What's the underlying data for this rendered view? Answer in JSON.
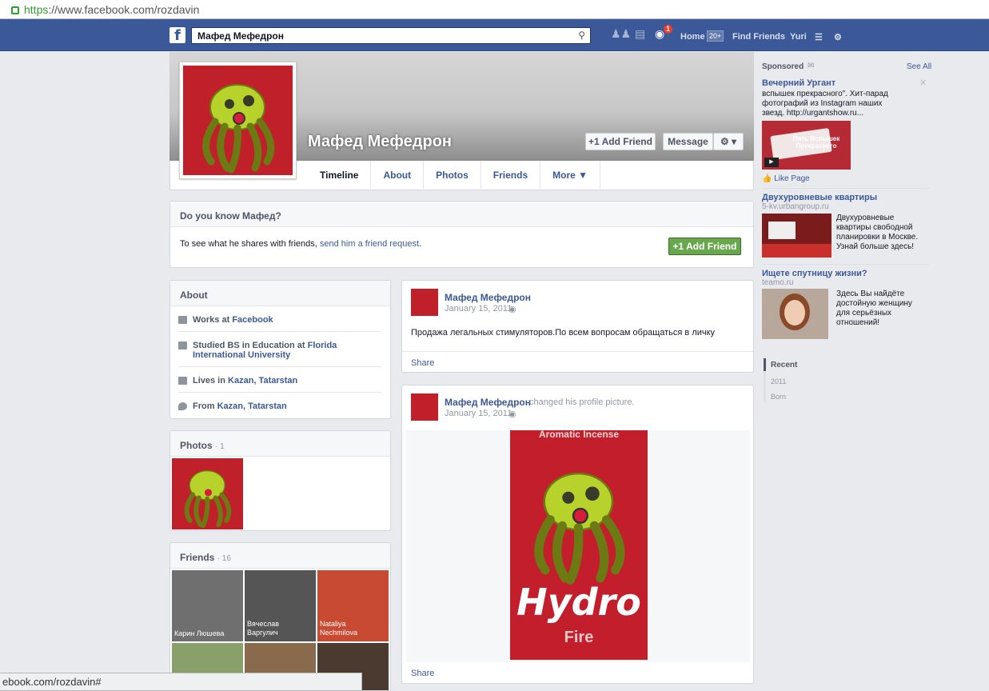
{
  "browser": {
    "url_https": "https",
    "url_rest": "://www.facebook.com/rozdavin"
  },
  "topbar": {
    "logo": "f",
    "search_value": "Мафед Мефедрон",
    "notif_badge": "1",
    "home_label": "Home",
    "home_count": "20+",
    "find_friends_label": "Find Friends",
    "user_label": "Yuri"
  },
  "profile": {
    "name": "Мафед Мефедрон",
    "add_friend_label": "Add Friend",
    "message_label": "Message",
    "tabs": [
      {
        "label": "Timeline"
      },
      {
        "label": "About"
      },
      {
        "label": "Photos"
      },
      {
        "label": "Friends"
      },
      {
        "label": "More ▼"
      }
    ]
  },
  "know": {
    "title": "Do you know Мафед?",
    "text": "To see what he shares with friends, ",
    "link": "send him a friend request",
    "dot": ".",
    "button": "Add Friend"
  },
  "about": {
    "title": "About",
    "works_pre": "Works at ",
    "works_link": "Facebook",
    "studied_pre": "Studied BS in Education at ",
    "studied_link": "Florida International University",
    "lives_pre": "Lives in ",
    "lives_link": "Kazan, Tatarstan",
    "from_pre": "From ",
    "from_link": "Kazan, Tatarstan"
  },
  "photos_box": {
    "title": "Photos",
    "count": "· 1"
  },
  "friends_box": {
    "title": "Friends",
    "count": "· 16",
    "names": [
      "Карин Люшева",
      "Вячеслав Варгулич",
      "Nataliya Nechmilova"
    ]
  },
  "posts": [
    {
      "author": "Мафед Мефедрон",
      "date": "January 15, 2011",
      "text": "Продажа легальных стимуляторов.По всем вопросам обращаться в личку",
      "share": "Share"
    },
    {
      "author": "Мафед Мефедрон",
      "action": "changed his profile picture.",
      "date": "January 15, 2011",
      "share": "Share",
      "image_text": {
        "top": "Aromatic Incense",
        "brand": "Hydro",
        "sub": "Fire"
      }
    }
  ],
  "sidebar": {
    "sponsored": "Sponsored",
    "see_all": "See All",
    "ads": [
      {
        "title": "Вечерний Ургант",
        "text": "вспышек прекрасного\". Хит-парад фотографий из Instagram наших звезд. http://urgantshow.ru...",
        "like": "Like Page",
        "img_text": "Пять Вспышек Прекрасного"
      },
      {
        "title": "Двухуровневые квартиры",
        "domain": "5-kv.urbangroup.ru",
        "text": "Двухуровневые квартиры свободной планировки в Москве. Узнай больше здесь!"
      },
      {
        "title": "Ищете спутницу жизни?",
        "domain": "teamo.ru",
        "text": "Здесь Вы найдёте достойную женщину для серьёзных отношений!"
      }
    ],
    "timeline_nav": [
      "Recent",
      "2011",
      "Born"
    ]
  },
  "statusbar": {
    "text": "ebook.com/rozdavin#"
  },
  "colors": {
    "fb_blue": "#3b5998",
    "green": "#69a74e",
    "badge_red": "#f03d25"
  }
}
